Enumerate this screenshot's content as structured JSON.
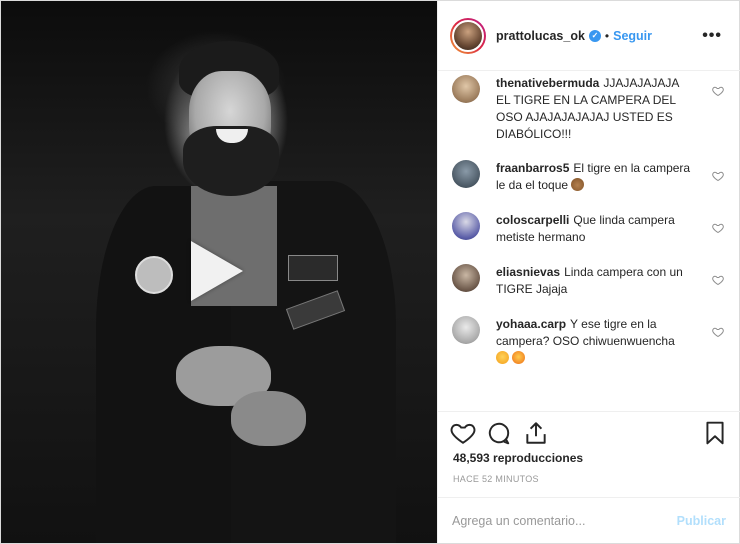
{
  "post": {
    "username": "prattolucas_ok",
    "separator": "•",
    "follow_label": "Seguir",
    "more_label": "•••",
    "verified_icon": "verified-badge-icon",
    "verified_mark": "✓"
  },
  "comments": [
    {
      "user": "thenativebermuda",
      "text": "JJAJAJAJAJA EL TIGRE EN LA CAMPERA DEL OSO AJAJAJAJAJAJ USTED ES DIABÓLICO!!!",
      "emojis": []
    },
    {
      "user": "fraanbarros5",
      "text": "El tigre en la campera le da el toque",
      "emojis": [
        "bear-face-emoji"
      ]
    },
    {
      "user": "coloscarpelli",
      "text": "Que linda campera metiste hermano",
      "emojis": []
    },
    {
      "user": "eliasnievas",
      "text": "Linda campera con un TIGRE Jajaja",
      "emojis": []
    },
    {
      "user": "yohaaa.carp",
      "text": "Y ese tigre en la campera? OSO chiwuenwuencha",
      "emojis": [
        "rofl-emoji",
        "star-struck-emoji"
      ]
    }
  ],
  "stats": {
    "views": "48,593 reproducciones",
    "time_ago": "HACE 52 MINUTOS"
  },
  "composer": {
    "placeholder": "Agrega un comentario...",
    "publish_label": "Publicar"
  },
  "colors": {
    "accent": "#3897f0",
    "publish_disabled": "#b2dffc",
    "muted": "#999999"
  }
}
